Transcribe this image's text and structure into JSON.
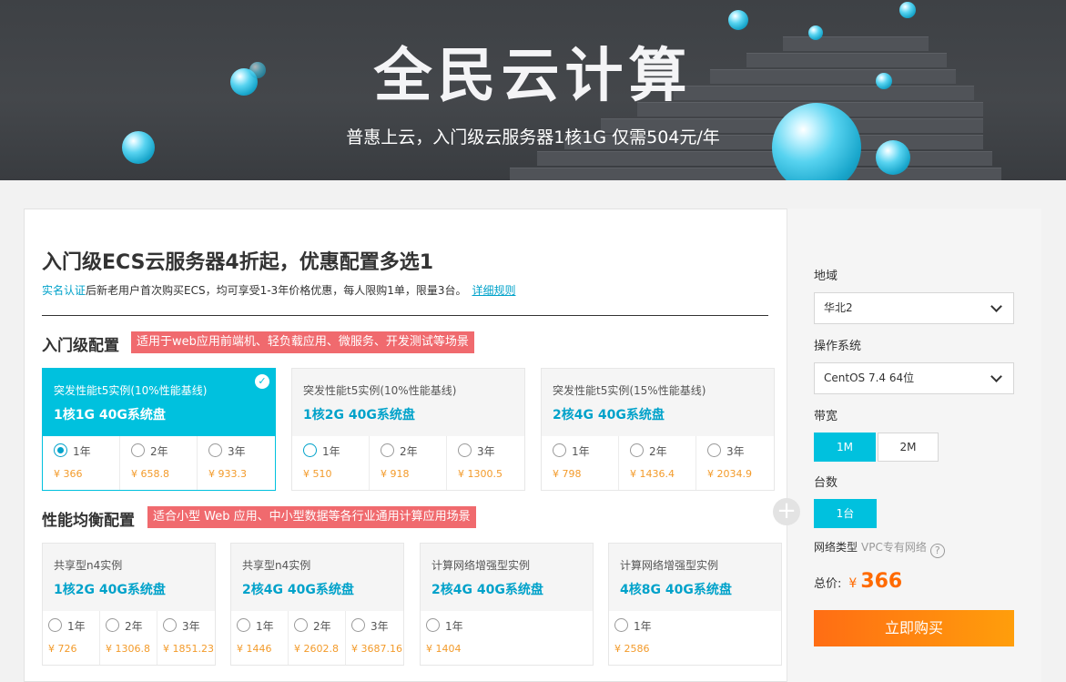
{
  "banner": {
    "title": "全民云计算",
    "subtitle": "普惠上云，入门级云服务器1核1G 仅需504元/年"
  },
  "main": {
    "title": "入门级ECS云服务器4折起，优惠配置多选1",
    "notice_link": "实名认证",
    "notice_text": "后新老用户首次购买ECS，均可享受1-3年价格优惠，每人限购1单，限量3台。",
    "rules_link": "详细规则"
  },
  "sections": [
    {
      "title": "入门级配置",
      "tag": "适用于web应用前端机、轻负载应用、微服务、开发测试等场景",
      "cards": [
        {
          "type": "突发性能t5实例(10%性能基线)",
          "spec": "1核1G 40G系统盘",
          "selected": true,
          "options": [
            {
              "year": "1年",
              "price": "¥ 366",
              "checked": true
            },
            {
              "year": "2年",
              "price": "¥ 658.8",
              "checked": false
            },
            {
              "year": "3年",
              "price": "¥ 933.3",
              "checked": false
            }
          ]
        },
        {
          "type": "突发性能t5实例(10%性能基线)",
          "spec": "1核2G 40G系统盘",
          "selected": false,
          "options": [
            {
              "year": "1年",
              "price": "¥ 510",
              "checked": false
            },
            {
              "year": "2年",
              "price": "¥ 918",
              "checked": false
            },
            {
              "year": "3年",
              "price": "¥ 1300.5",
              "checked": false
            }
          ]
        },
        {
          "type": "突发性能t5实例(15%性能基线)",
          "spec": "2核4G 40G系统盘",
          "selected": false,
          "options": [
            {
              "year": "1年",
              "price": "¥ 798",
              "checked": false
            },
            {
              "year": "2年",
              "price": "¥ 1436.4",
              "checked": false
            },
            {
              "year": "3年",
              "price": "¥ 2034.9",
              "checked": false
            }
          ]
        }
      ]
    },
    {
      "title": "性能均衡配置",
      "tag": "适合小型 Web 应用、中小型数据等各行业通用计算应用场景",
      "cards": [
        {
          "type": "共享型n4实例",
          "spec": "1核2G 40G系统盘",
          "selected": false,
          "options": [
            {
              "year": "1年",
              "price": "¥ 726",
              "checked": false
            },
            {
              "year": "2年",
              "price": "¥ 1306.8",
              "checked": false
            },
            {
              "year": "3年",
              "price": "¥ 1851.23",
              "checked": false
            }
          ]
        },
        {
          "type": "共享型n4实例",
          "spec": "2核4G 40G系统盘",
          "selected": false,
          "options": [
            {
              "year": "1年",
              "price": "¥ 1446",
              "checked": false
            },
            {
              "year": "2年",
              "price": "¥ 2602.8",
              "checked": false
            },
            {
              "year": "3年",
              "price": "¥ 3687.16",
              "checked": false
            }
          ]
        },
        {
          "type": "计算网络增强型实例",
          "spec": "2核4G 40G系统盘",
          "selected": false,
          "options": [
            {
              "year": "1年",
              "price": "¥ 1404",
              "checked": false
            }
          ]
        },
        {
          "type": "计算网络增强型实例",
          "spec": "4核8G 40G系统盘",
          "selected": false,
          "options": [
            {
              "year": "1年",
              "price": "¥ 2586",
              "checked": false
            }
          ]
        }
      ]
    }
  ],
  "sidebar": {
    "region_label": "地域",
    "region_value": "华北2",
    "os_label": "操作系统",
    "os_value": "CentOS 7.4 64位",
    "bandwidth_label": "带宽",
    "bandwidth_options": [
      "1M",
      "2M"
    ],
    "bandwidth_selected": "1M",
    "count_label": "台数",
    "count_value": "1台",
    "network_label": "网络类型",
    "network_value": "VPC专有网络",
    "help_icon": "?",
    "total_label": "总价:",
    "currency": "¥",
    "total_value": "366",
    "buy_label": "立即购买"
  },
  "colors": {
    "accent": "#00c1de",
    "link": "#00a2ca",
    "price": "#f39b2b",
    "tag": "#f06a6e",
    "buy_start": "#ff6d14",
    "buy_end": "#ff9e0b"
  }
}
